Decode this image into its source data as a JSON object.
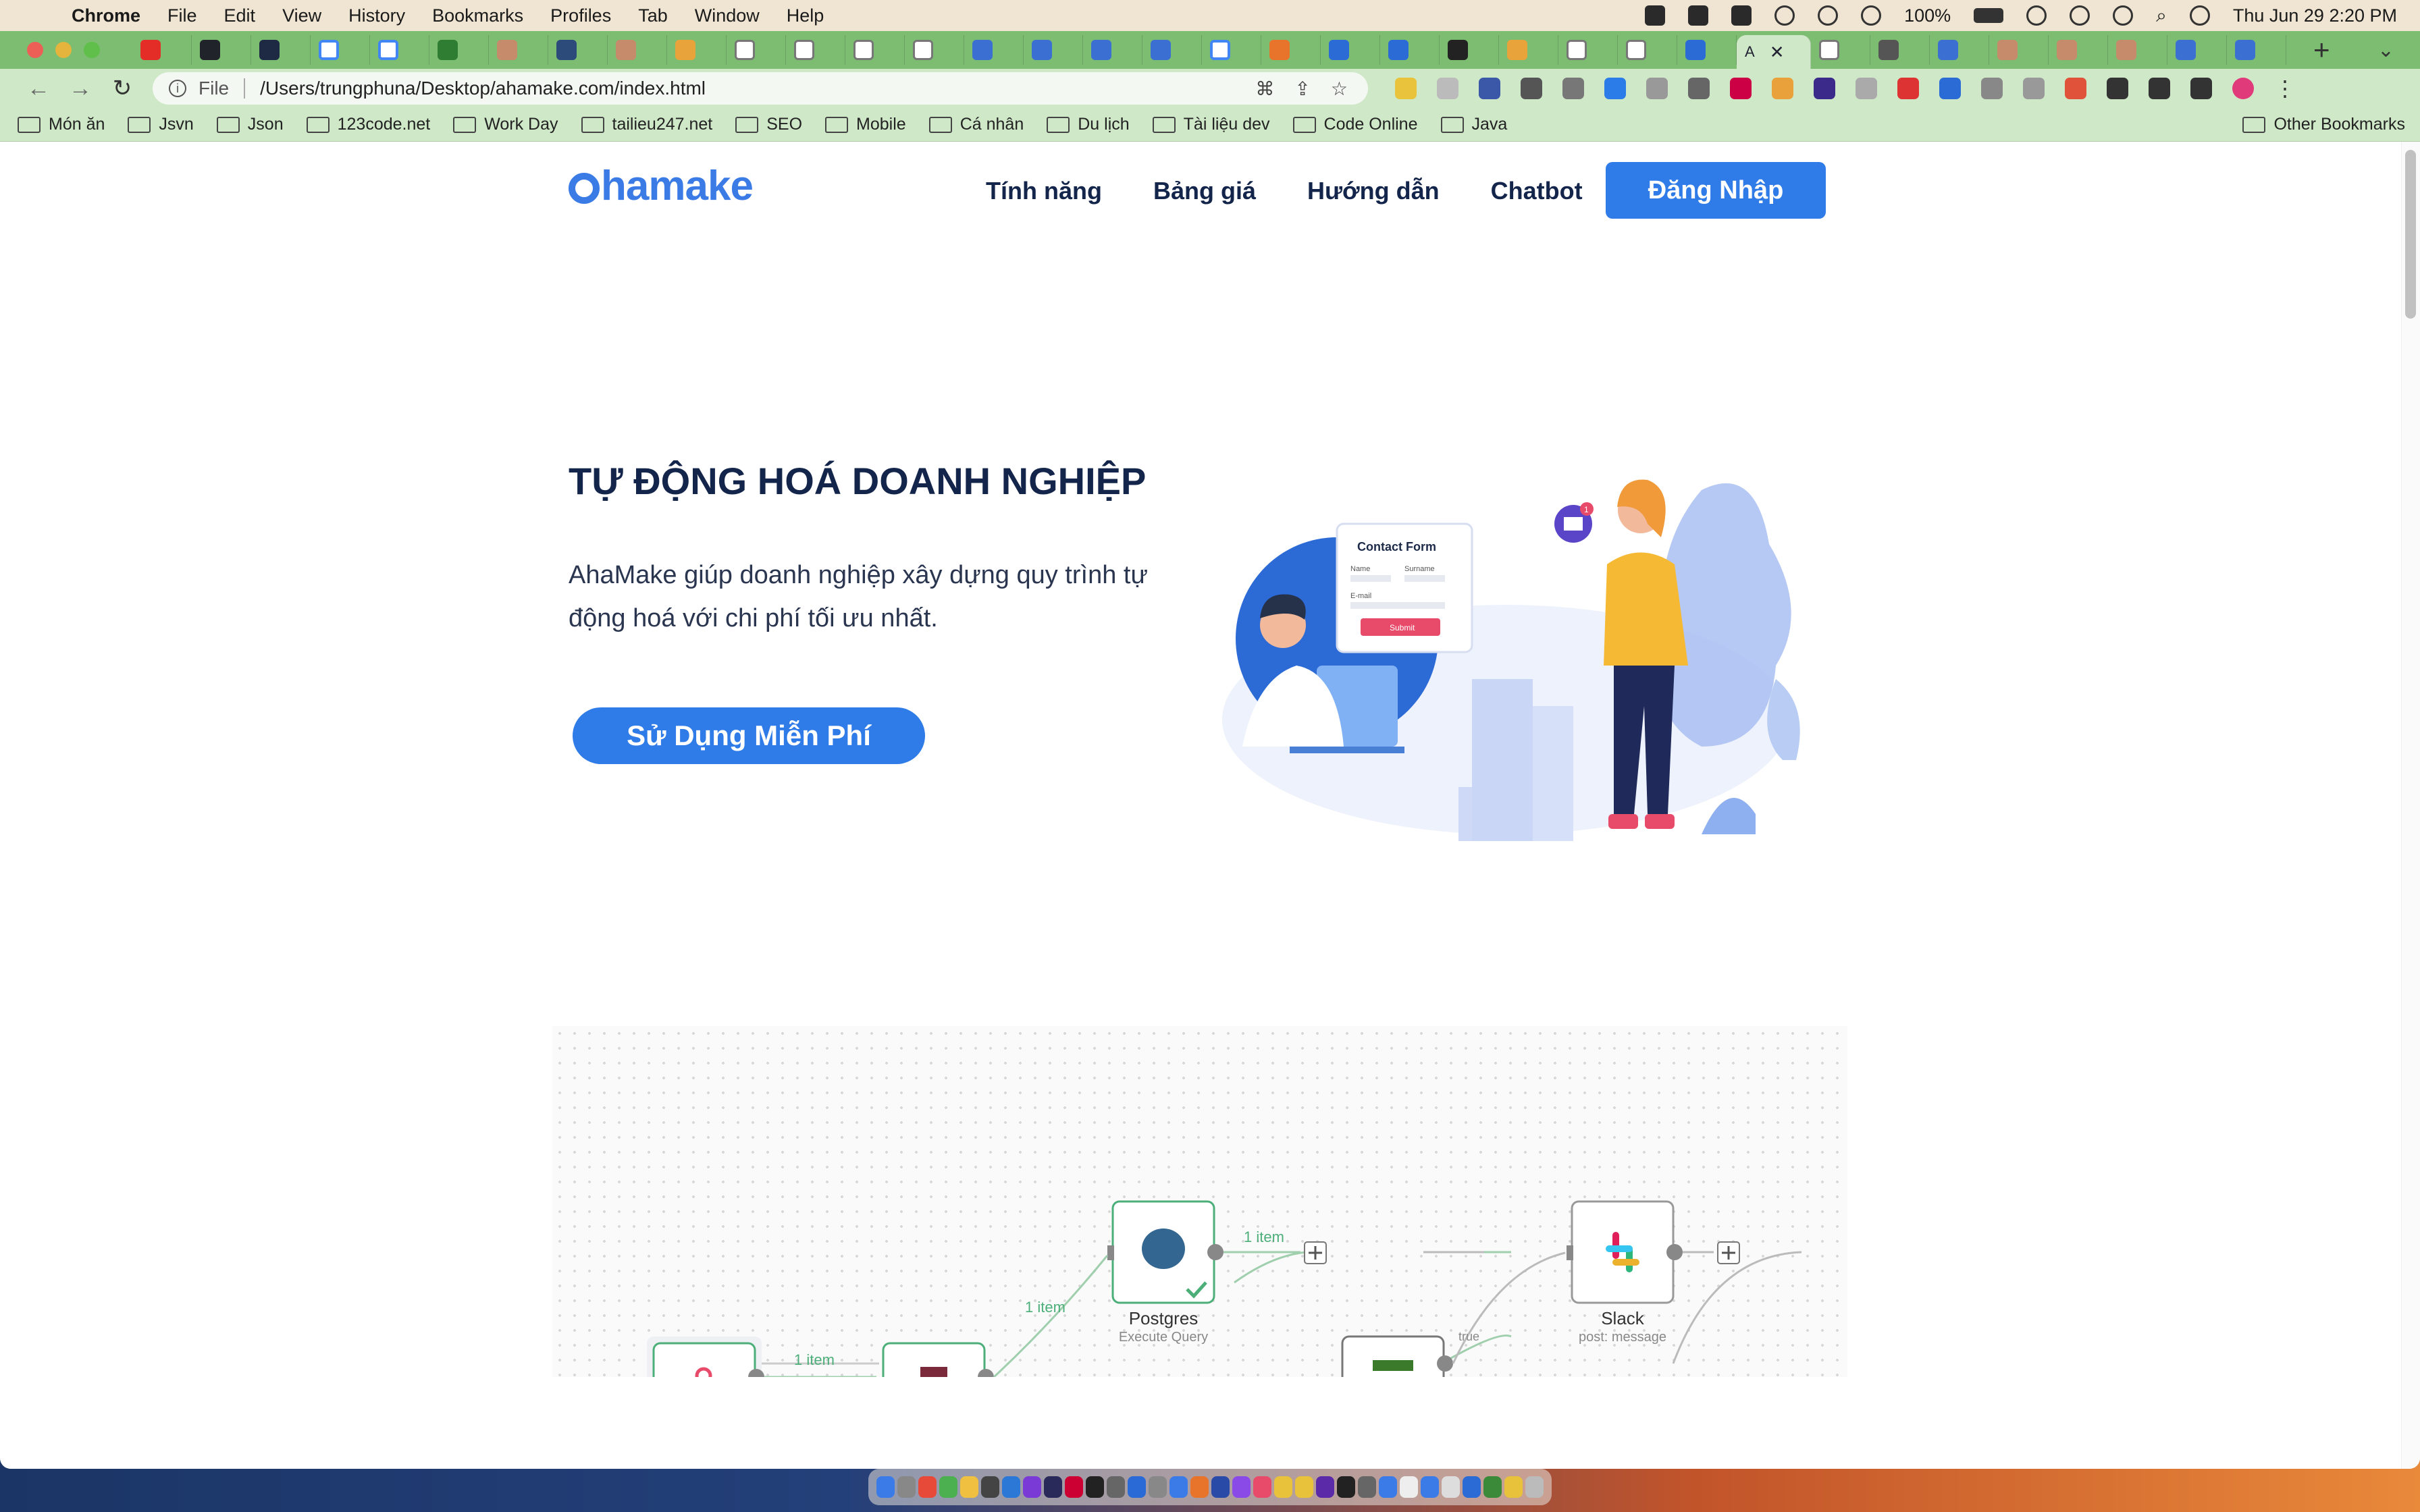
{
  "menubar": {
    "app": "Chrome",
    "items": [
      "File",
      "Edit",
      "View",
      "History",
      "Bookmarks",
      "Profiles",
      "Tab",
      "Window",
      "Help"
    ],
    "battery": "100%",
    "datetime": "Thu Jun 29  2:20 PM"
  },
  "browser": {
    "active_tab_label": "A",
    "address": "/Users/trungphuna/Desktop/ahamake.com/index.html",
    "scheme_label": "File",
    "bookmarks": [
      "Món ăn",
      "Jsvn",
      "Json",
      "123code.net",
      "Work Day",
      "tailieu247.net",
      "SEO",
      "Mobile",
      "Cá nhân",
      "Du lịch",
      "Tài liệu dev",
      "Code Online",
      "Java"
    ],
    "other_bookmarks": "Other Bookmarks"
  },
  "site": {
    "logo": "hamake",
    "nav": [
      "Tính năng",
      "Bảng giá",
      "Hướng dẫn",
      "Chatbot"
    ],
    "login_label": "Đăng Nhập",
    "hero_title": "TỰ ĐỘNG HOÁ DOANH NGHIỆP",
    "hero_desc_line1": "AhaMake giúp doanh nghiệp xây dựng quy trình tự",
    "hero_desc_line2": "động hoá với chi phí tối ưu nhất.",
    "cta_label": "Sử Dụng Miễn Phí"
  },
  "illustration": {
    "form_title": "Contact Form",
    "field_name": "Name",
    "field_surname": "Surname",
    "field_email": "E-mail",
    "submit": "Submit",
    "notification_count": "1"
  },
  "workflow": {
    "postgres_label": "Postgres",
    "postgres_sub": "Execute Query",
    "slack_label": "Slack",
    "slack_sub": "post: message",
    "edge1": "1 item",
    "edge2": "1 item",
    "edge3": "1 item",
    "edge_true": "true"
  },
  "colors": {
    "brand": "#2f7be8",
    "heading": "#13254a",
    "tabstrip": "#7dbd72",
    "toolbar": "#cfe8c8"
  }
}
